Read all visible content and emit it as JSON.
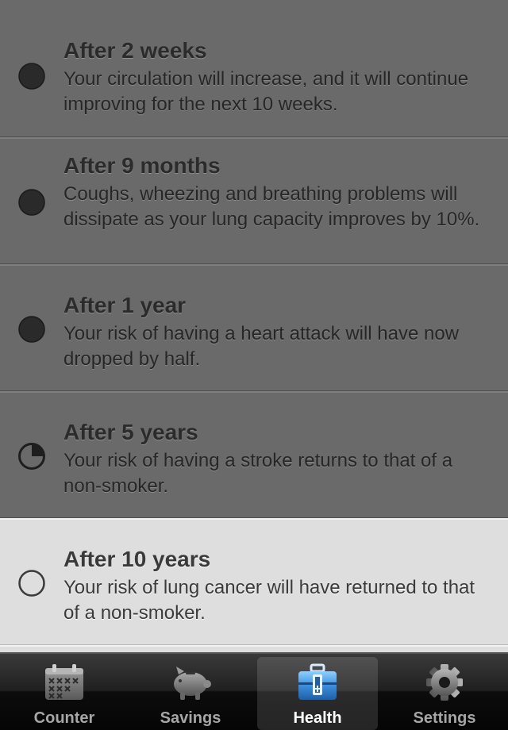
{
  "milestones": [
    {
      "title": "After 2 weeks",
      "description": "Your circulation will increase, and it will continue improving for the next 10 weeks.",
      "status": "complete",
      "progress": 1.0
    },
    {
      "title": "After 9 months",
      "description": "Coughs, wheezing and breathing problems will dissipate as your lung capacity improves by 10%.",
      "status": "complete",
      "progress": 1.0
    },
    {
      "title": "After 1 year",
      "description": "Your risk of having a heart attack will have now dropped by half.",
      "status": "complete",
      "progress": 1.0
    },
    {
      "title": "After 5 years",
      "description": "Your risk of having a stroke returns to that of a non-smoker.",
      "status": "in-progress",
      "progress": 0.25
    },
    {
      "title": "After 10 years",
      "description": "Your risk of lung cancer will have returned to that of a non-smoker.",
      "status": "pending",
      "progress": 0.0
    }
  ],
  "tabbar": {
    "tabs": [
      {
        "label": "Counter",
        "icon": "calendar-icon",
        "active": false
      },
      {
        "label": "Savings",
        "icon": "piggy-bank-icon",
        "active": false
      },
      {
        "label": "Health",
        "icon": "medical-kit-icon",
        "active": true
      },
      {
        "label": "Settings",
        "icon": "gear-icon",
        "active": false
      }
    ]
  },
  "colors": {
    "complete_row": "#6a6a6a",
    "pending_row": "#dedede",
    "indicator": "#222222",
    "active_tab_icon": "#3d8fdc"
  }
}
